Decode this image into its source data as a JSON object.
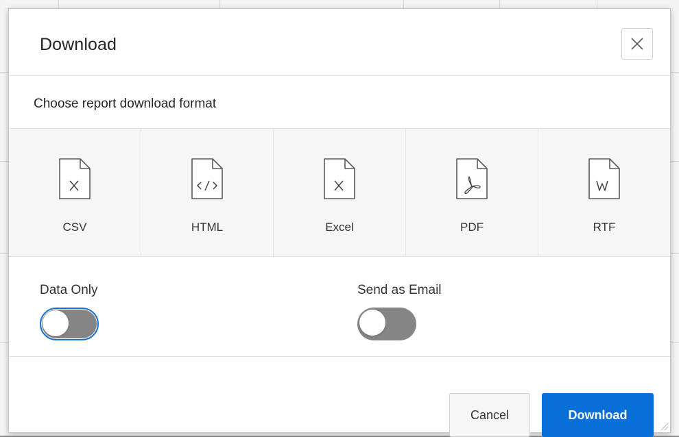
{
  "dialog": {
    "title": "Download",
    "close_icon": "close-icon"
  },
  "format_section": {
    "label": "Choose report download format",
    "selected": "CSV",
    "formats": [
      {
        "label": "CSV",
        "icon": "csv-file-icon",
        "glyph": "X"
      },
      {
        "label": "HTML",
        "icon": "html-file-icon",
        "glyph": "</>"
      },
      {
        "label": "Excel",
        "icon": "excel-file-icon",
        "glyph": "X"
      },
      {
        "label": "PDF",
        "icon": "pdf-file-icon",
        "glyph": "pdf"
      },
      {
        "label": "RTF",
        "icon": "rtf-file-icon",
        "glyph": "W"
      }
    ]
  },
  "options": {
    "data_only": {
      "label": "Data Only",
      "on": false
    },
    "send_as_email": {
      "label": "Send as Email",
      "on": false
    }
  },
  "footer": {
    "cancel_label": "Cancel",
    "download_label": "Download"
  },
  "colors": {
    "accent": "#0a6fd8",
    "toggle_off": "#858585",
    "tile_bg": "#f6f6f6"
  }
}
